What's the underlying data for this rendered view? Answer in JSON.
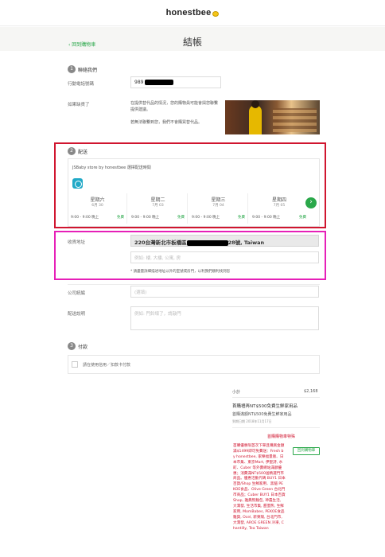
{
  "header": {
    "brand": "honestbee",
    "back_label": "‹ 回到購物車",
    "title": "結帳"
  },
  "contact": {
    "num": "1",
    "title": "聯絡我們",
    "phone_label": "行動電話號碼",
    "phone_value": "989",
    "missed_label": "如果缺貨了",
    "missed_text_1": "在提供替代品的情況，您的購物員可能會與您聯繫提供建議。",
    "missed_text_2": "若無法聯繫到您，我們不會購買替代品。"
  },
  "delivery": {
    "num": "2",
    "title": "配送",
    "store_line": "JSBaby store by honestbee 選擇配送時間",
    "days": [
      {
        "name": "星期六",
        "date": "6月 30",
        "slot": "9:00 - 9:00 晚上",
        "pick": "免費"
      },
      {
        "name": "星期二",
        "date": "7月 03",
        "slot": "9:00 - 9:00 晚上",
        "pick": "免費"
      },
      {
        "name": "星期三",
        "date": "7月 04",
        "slot": "9:00 - 9:00 晚上",
        "pick": "免費"
      },
      {
        "name": "星期四",
        "date": "7月 05",
        "slot": "9:00 - 9:00 晚上",
        "pick": "免費"
      }
    ],
    "next_icon": "›"
  },
  "address": {
    "label": "收貨地址",
    "value_start": "220台灣新北市板橋區",
    "value_end": "28號, Taiwan",
    "line2_placeholder": "例如: 樓, 大樓, 公寓, 房",
    "note": "* 請盡量詳細描述地址以外的室號或房門，以利我們順利找到您"
  },
  "company": {
    "label": "公司統編",
    "placeholder": "(選填)"
  },
  "instructions": {
    "label": "配送說明",
    "placeholder": "例如: 門鈴壞了，請敲門"
  },
  "payment": {
    "num": "3",
    "title": "付款",
    "option": "請在使用信用／扣款卡付款"
  },
  "summary": {
    "subtotal_label": "小計",
    "subtotal_value": "$2,168",
    "promo_title": "首購禮再NT$500免費生鮮家用品",
    "promo_sub": "首購滿額NT$500免費生鮮家用品",
    "promo_date": "到期日期 2018年11月17日",
    "promo_link": "首購購物車特殊",
    "promo_button": "回到購物車",
    "red_text": "首購優惠限首次下單且購買金額滿$1499即可免費送：Fresh by honestbee, 家樂福量販、日本市集、東京Mart, 伊聖詩, 水町、Cuber 等外賣網站滿額優惠；消費滿NT$500送精選門市商品。優惠活動代碼 BUY1 日本百貨/Shop 生鮮家用、黑貓 PEKOE食品、Olive Green 台北門市商品；Cuber BUY1 日本百貨Shop, 雅典熊麵包, 神農生活, 大潤發, 生活市集, 甜蜜熊, 生鮮家用, MomBabes, PEKOE食品雜貨, Ocel, 新東陽, 台北門市, 大潤發, AROE GREEN 冷凍, Chantilly, Tea Taiwan"
  }
}
